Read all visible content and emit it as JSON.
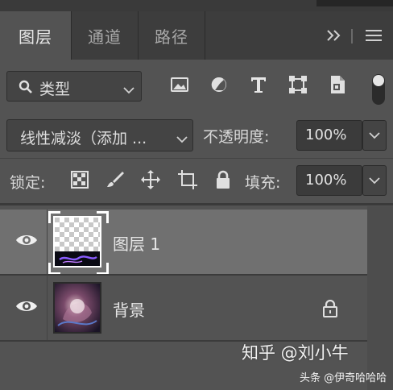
{
  "tabs": [
    {
      "label": "图层",
      "active": true
    },
    {
      "label": "通道",
      "active": false
    },
    {
      "label": "路径",
      "active": false
    }
  ],
  "toolbar": {
    "expand_icon": "double-chevron-right-icon",
    "menu_icon": "hamburger-menu-icon"
  },
  "filter": {
    "kind_label": "类型",
    "icons": [
      "image-filter-icon",
      "adjustment-filter-icon",
      "type-filter-icon",
      "shape-filter-icon",
      "smart-object-filter-icon"
    ]
  },
  "blend": {
    "mode": "线性减淡（添加 ...",
    "opacity_label": "不透明度:",
    "opacity_value": "100%"
  },
  "lock": {
    "label": "锁定:",
    "icons": [
      "lock-transparent-pixels-icon",
      "lock-image-pixels-icon",
      "lock-position-icon",
      "artboard-lock-icon",
      "lock-all-icon"
    ],
    "fill_label": "填充:",
    "fill_value": "100%"
  },
  "layers": [
    {
      "name": "图层 1",
      "selected": true,
      "visible": true,
      "locked": false
    },
    {
      "name": "背景",
      "selected": false,
      "visible": true,
      "locked": true
    }
  ],
  "watermark": {
    "main": "知乎 @刘小牛",
    "sub": "头条 @伊奇哈哈哈"
  },
  "colors": {
    "panel": "#535353",
    "tabbar": "#3d3d3d",
    "selected_row": "#707070"
  }
}
